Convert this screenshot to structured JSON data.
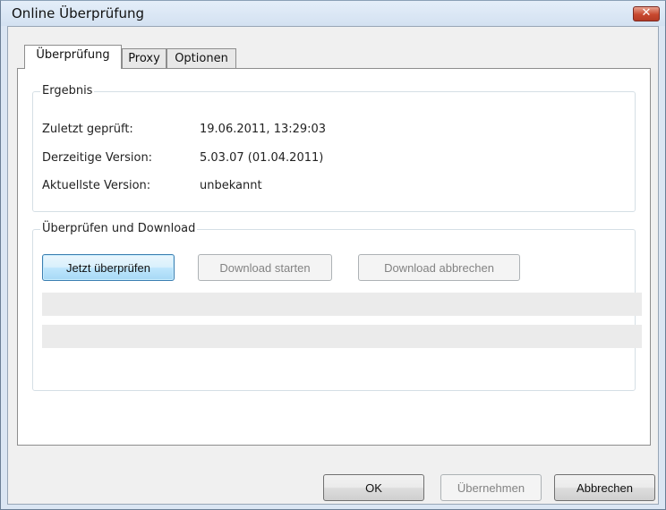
{
  "window": {
    "title": "Online Überprüfung",
    "close_glyph": "✕"
  },
  "tabs": [
    {
      "label": "Überprüfung",
      "active": true
    },
    {
      "label": "Proxy",
      "active": false
    },
    {
      "label": "Optionen",
      "active": false
    }
  ],
  "ergebnis": {
    "legend": "Ergebnis",
    "rows": [
      {
        "label": "Zuletzt geprüft:",
        "value": "19.06.2011, 13:29:03"
      },
      {
        "label": "Derzeitige Version:",
        "value": "5.03.07 (01.04.2011)"
      },
      {
        "label": "Aktuellste Version:",
        "value": "unbekannt"
      }
    ]
  },
  "download": {
    "legend": "Überprüfen und Download",
    "check_now_label": "Jetzt überprüfen",
    "start_download_label": "Download starten",
    "cancel_download_label": "Download abbrechen",
    "progress": [
      0,
      0
    ]
  },
  "footer": {
    "ok_label": "OK",
    "apply_label": "Übernehmen",
    "cancel_label": "Abbrechen"
  },
  "colors": {
    "focused_button": "#bee6fd",
    "close_button": "#c8492f",
    "disabled_text": "#838383"
  }
}
